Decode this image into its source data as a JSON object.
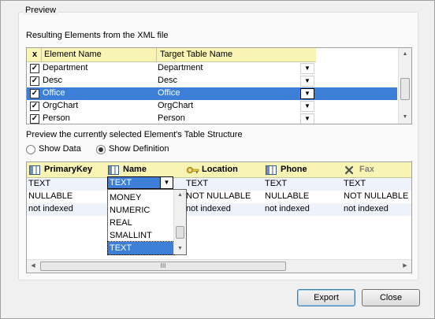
{
  "preview_group": {
    "title": "Preview"
  },
  "elements_label": "Resulting Elements from the XML file",
  "elements_grid": {
    "header": {
      "check": "x",
      "element_name": "Element Name",
      "target_table_name": "Target Table Name"
    },
    "rows": [
      {
        "element": "Department",
        "target": "Department",
        "checked": true,
        "selected": false
      },
      {
        "element": "Desc",
        "target": "Desc",
        "checked": true,
        "selected": false
      },
      {
        "element": "Office",
        "target": "Office",
        "checked": true,
        "selected": true
      },
      {
        "element": "OrgChart",
        "target": "OrgChart",
        "checked": true,
        "selected": false
      },
      {
        "element": "Person",
        "target": "Person",
        "checked": true,
        "selected": false
      }
    ]
  },
  "structure_label": "Preview the currently selected Element's Table Structure",
  "view_mode": {
    "show_data": "Show Data",
    "show_definition": "Show Definition",
    "selected": "show_definition"
  },
  "structure_grid": {
    "columns": [
      {
        "name": "PrimaryKey",
        "icon": "column-icon"
      },
      {
        "name": "Name",
        "icon": "column-icon"
      },
      {
        "name": "Location",
        "icon": "key-icon"
      },
      {
        "name": "Phone",
        "icon": "column-icon"
      },
      {
        "name": "Fax",
        "icon": "excluded-column-icon"
      }
    ],
    "rows": [
      [
        "TEXT",
        "TEXT",
        "TEXT",
        "TEXT",
        "TEXT"
      ],
      [
        "NULLABLE",
        "",
        "NOT NULLABLE",
        "NULLABLE",
        "NOT NULLABLE"
      ],
      [
        "not indexed",
        "",
        "not indexed",
        "not indexed",
        "not indexed"
      ]
    ],
    "type_combo": {
      "value": "TEXT",
      "options": [
        "MONEY",
        "NUMERIC",
        "REAL",
        "SMALLINT",
        "TEXT"
      ],
      "selected": "TEXT"
    },
    "hscroll_grip": "III"
  },
  "buttons": {
    "export": "Export",
    "close": "Close"
  },
  "colors": {
    "header_bg": "#f8f4b4",
    "selection": "#3d7fd6",
    "alt_row": "#eef3fb"
  }
}
